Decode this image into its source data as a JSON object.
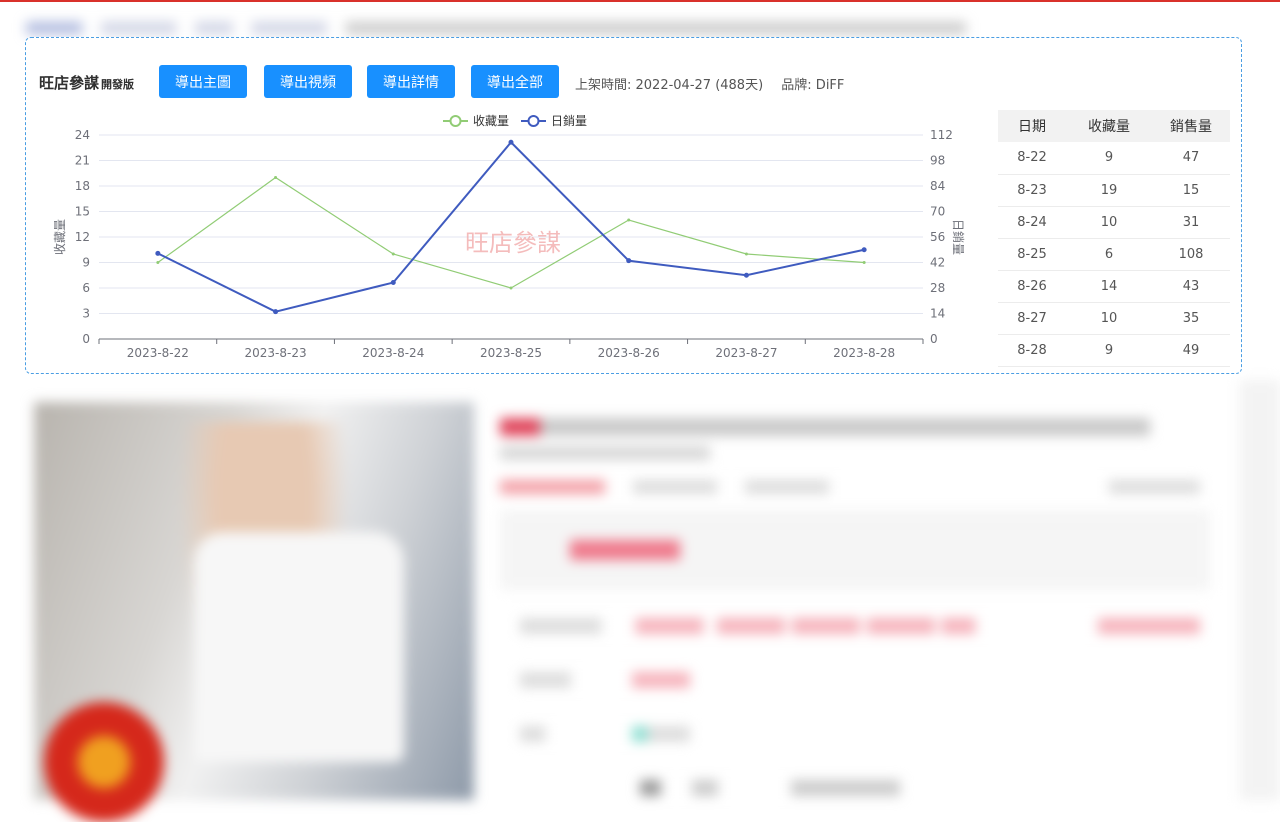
{
  "toolbar": {
    "brand": "旺店參謀",
    "edition": "開發版",
    "buttons": [
      "導出主圖",
      "導出視頻",
      "導出詳情",
      "導出全部"
    ],
    "listed_time": "上架時間: 2022-04-27 (488天)",
    "brand_name": "品牌: DiFF"
  },
  "chart_data": {
    "type": "line",
    "watermark": "旺店參謀",
    "x": [
      "2023-8-22",
      "2023-8-23",
      "2023-8-24",
      "2023-8-25",
      "2023-8-26",
      "2023-8-27",
      "2023-8-28"
    ],
    "series": [
      {
        "name": "收藏量",
        "axis": "left",
        "color": "#91cc75",
        "values": [
          9,
          19,
          10,
          6,
          14,
          10,
          9
        ]
      },
      {
        "name": "日銷量",
        "axis": "right",
        "color": "#3f5bbf",
        "values": [
          47,
          15,
          31,
          108,
          43,
          35,
          49
        ]
      }
    ],
    "y_left": {
      "label": "收藏量",
      "range": [
        0,
        24
      ],
      "ticks": [
        0,
        3,
        6,
        9,
        12,
        15,
        18,
        21,
        24
      ]
    },
    "y_right": {
      "label": "日銷量",
      "range": [
        0,
        112
      ],
      "ticks": [
        0,
        14,
        28,
        42,
        56,
        70,
        84,
        98,
        112
      ]
    },
    "legend_position": "top-center",
    "grid": true
  },
  "table": {
    "headers": [
      "日期",
      "收藏量",
      "銷售量"
    ],
    "rows": [
      [
        "8-22",
        "9",
        "47"
      ],
      [
        "8-23",
        "19",
        "15"
      ],
      [
        "8-24",
        "10",
        "31"
      ],
      [
        "8-25",
        "6",
        "108"
      ],
      [
        "8-26",
        "14",
        "43"
      ],
      [
        "8-27",
        "10",
        "35"
      ],
      [
        "8-28",
        "9",
        "49"
      ]
    ]
  }
}
